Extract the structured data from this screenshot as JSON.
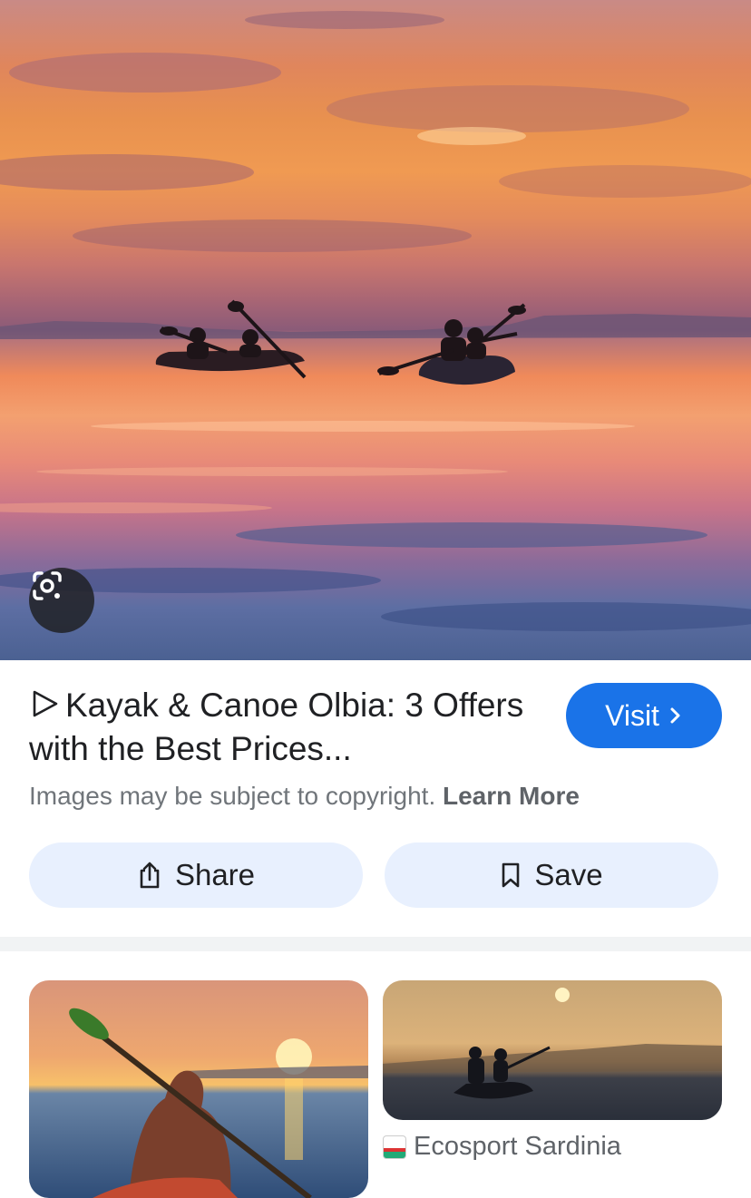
{
  "result": {
    "title": "Kayak & Canoe Olbia: 3 Offers with the Best Prices...",
    "visit_label": "Visit",
    "copyright_text": "Images may be subject to copyright.",
    "learn_more_label": "Learn More",
    "share_label": "Share",
    "save_label": "Save"
  },
  "related": [
    {
      "source": ""
    },
    {
      "source": "Ecosport Sardinia"
    }
  ],
  "colors": {
    "accent": "#1a73e8",
    "button_bg": "#e8f0fe",
    "muted_text": "#70757a"
  },
  "icons": [
    "google-lens-icon",
    "play-triangle-icon",
    "chevron-right-icon",
    "share-icon",
    "bookmark-icon",
    "site-favicon"
  ]
}
